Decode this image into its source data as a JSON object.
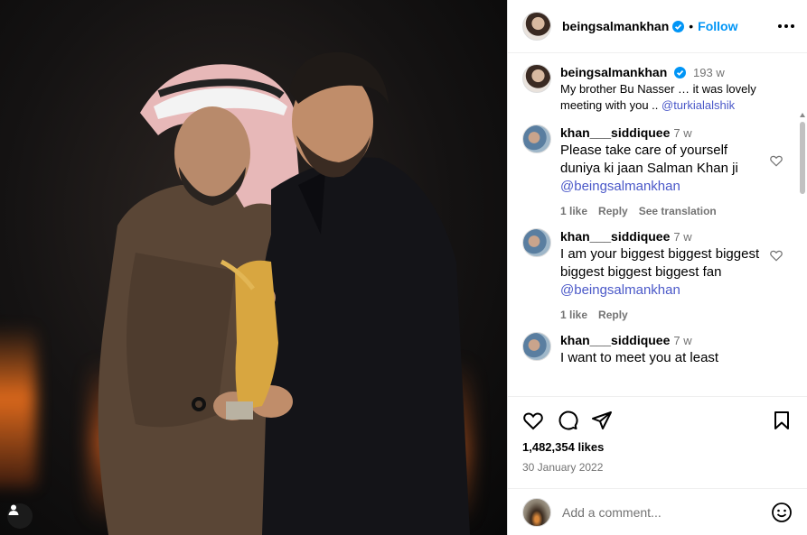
{
  "post": {
    "author": "beingsalmankhan",
    "follow_label": "Follow",
    "separator": "•"
  },
  "caption": {
    "author": "beingsalmankhan",
    "ago": "193 w",
    "text": "My brother Bu Nasser … it was lovely meeting with you .. ",
    "mention": "@turkialalshik"
  },
  "comments": [
    {
      "author": "khan___siddiquee",
      "ago": "7 w",
      "text": "Please take care of yourself duniya ki jaan Salman Khan ji ",
      "mention": "@beingsalmankhan",
      "likes": "1 like",
      "reply": "Reply",
      "translate": "See translation"
    },
    {
      "author": "khan___siddiquee",
      "ago": "7 w",
      "text": "I am your biggest biggest biggest biggest biggest biggest fan ",
      "mention": "@beingsalmankhan",
      "likes": "1 like",
      "reply": "Reply"
    },
    {
      "author": "khan___siddiquee",
      "ago": "7 w",
      "text": "I want to meet you at least"
    }
  ],
  "stats": {
    "likes": "1,482,354 likes",
    "date": "30 January 2022"
  },
  "add_comment": {
    "placeholder": "Add a comment..."
  },
  "colors": {
    "accent": "#0095f6",
    "mention": "#4a58c8",
    "muted": "#737373"
  }
}
